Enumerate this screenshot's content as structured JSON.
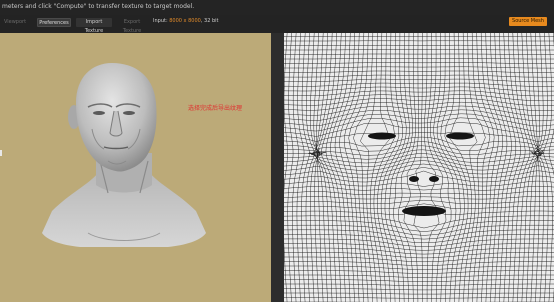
{
  "header": {
    "hint_text": "meters and click \"Compute\" to transfer texture to target model."
  },
  "toolbar": {
    "tabs": [
      {
        "label": "Viewport"
      },
      {
        "label": "Preferences"
      },
      {
        "label": "Import Texture"
      },
      {
        "label": "Export Texture"
      }
    ],
    "input_prefix": "Input:",
    "input_dims": "8000 x 8000",
    "input_suffix": ", 32 bit",
    "source_button": "Source Mesh"
  },
  "viewport": {
    "annotation": "选择完成后导出纹理"
  },
  "colors": {
    "accent": "#e88a1e",
    "viewport_bg": "#bcaa78",
    "annotation": "#e03030",
    "wireframe": "#1a1a1a"
  }
}
